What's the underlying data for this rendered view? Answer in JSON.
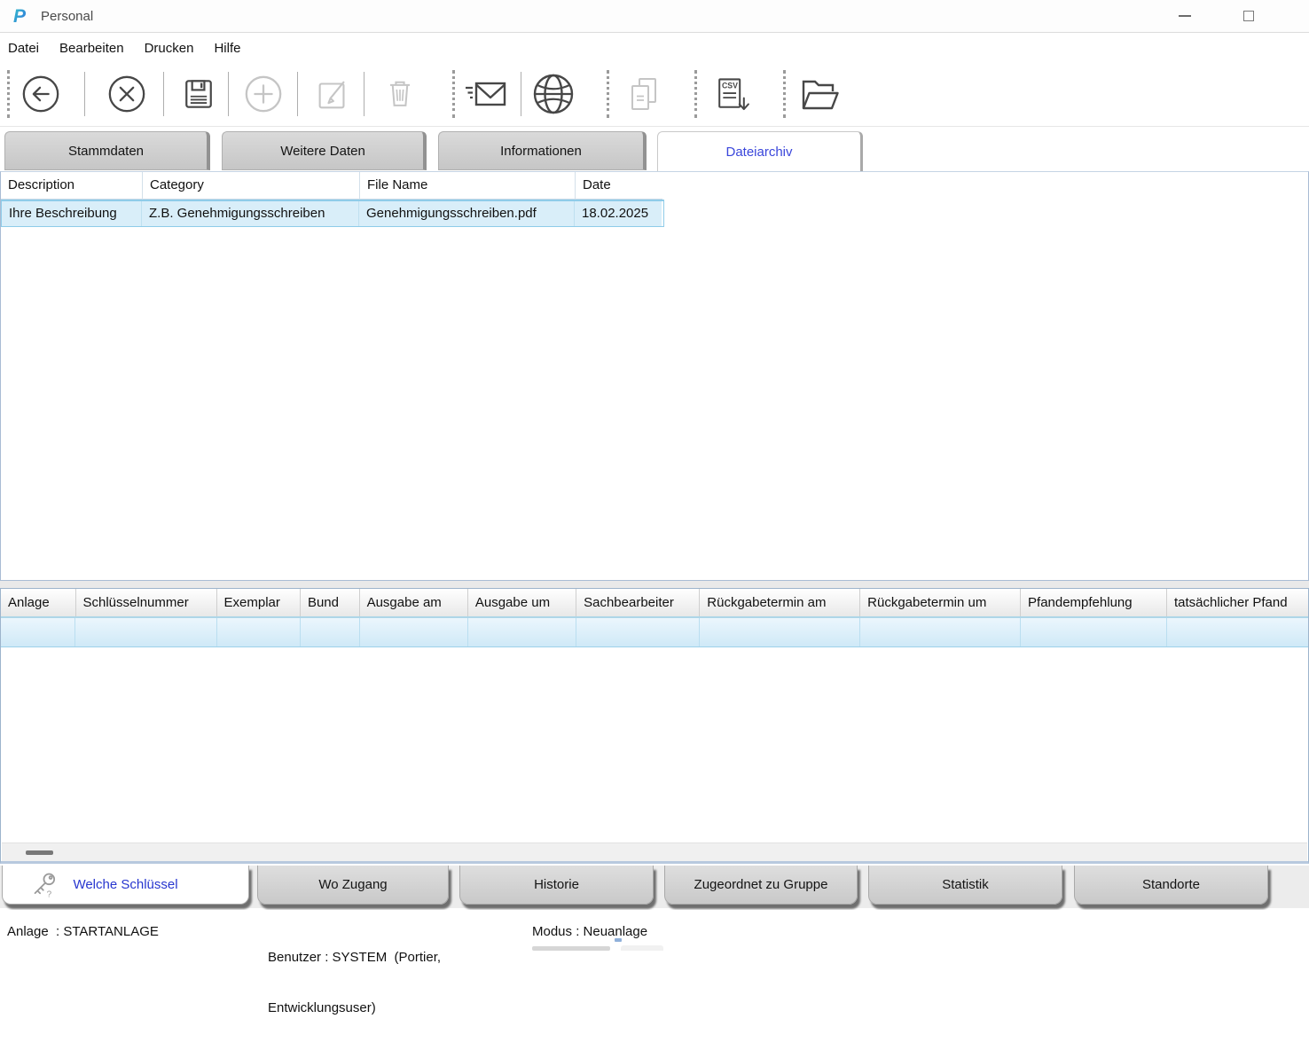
{
  "window": {
    "title": "Personal"
  },
  "menu": {
    "items": [
      "Datei",
      "Bearbeiten",
      "Drucken",
      "Hilfe"
    ]
  },
  "toolbar": {
    "csv_icon_text": "CSV",
    "buttons": [
      {
        "name": "back",
        "enabled": true
      },
      {
        "name": "cancel",
        "enabled": true
      },
      {
        "name": "save",
        "enabled": true
      },
      {
        "name": "add",
        "enabled": false
      },
      {
        "name": "edit",
        "enabled": false
      },
      {
        "name": "delete",
        "enabled": false
      },
      {
        "name": "email",
        "enabled": true
      },
      {
        "name": "web",
        "enabled": true
      },
      {
        "name": "copy",
        "enabled": false
      },
      {
        "name": "csv-export",
        "enabled": true
      },
      {
        "name": "open-folder",
        "enabled": true
      }
    ]
  },
  "tabs": [
    {
      "label": "Stammdaten",
      "active": false
    },
    {
      "label": "Weitere Daten",
      "active": false
    },
    {
      "label": "Informationen",
      "active": false
    },
    {
      "label": "Dateiarchiv",
      "active": true
    }
  ],
  "file_table": {
    "columns": [
      "Description",
      "Category",
      "File Name",
      "Date"
    ],
    "rows": [
      [
        "Ihre Beschreibung",
        "Z.B. Genehmigungsschreiben",
        "Genehmigungsschreiben.pdf",
        "18.02.2025"
      ]
    ]
  },
  "key_table": {
    "columns": [
      "Anlage",
      "Schlüsselnummer",
      "Exemplar",
      "Bund",
      "Ausgabe am",
      "Ausgabe um",
      "Sachbearbeiter",
      "Rückgabetermin am",
      "Rückgabetermin um",
      "Pfandempfehlung",
      "tatsächlicher Pfand"
    ]
  },
  "bottom_tabs": [
    {
      "label": "Welche Schlüssel",
      "active": true
    },
    {
      "label": "Wo Zugang",
      "active": false
    },
    {
      "label": "Historie",
      "active": false
    },
    {
      "label": "Zugeordnet zu Gruppe",
      "active": false
    },
    {
      "label": "Statistik",
      "active": false
    },
    {
      "label": "Standorte",
      "active": false
    }
  ],
  "statusbar": {
    "anlage": "Anlage  : STARTANLAGE",
    "benutzer_line1": "Benutzer : SYSTEM  (Portier,",
    "benutzer_line2": "Entwicklungsuser)",
    "modus": "Modus : Neuanlage"
  },
  "colors": {
    "accent_blue": "#3a46db",
    "selection_fill": "#d9eef9",
    "selection_border": "#8fcce9",
    "panel_border": "#9db4cc"
  }
}
